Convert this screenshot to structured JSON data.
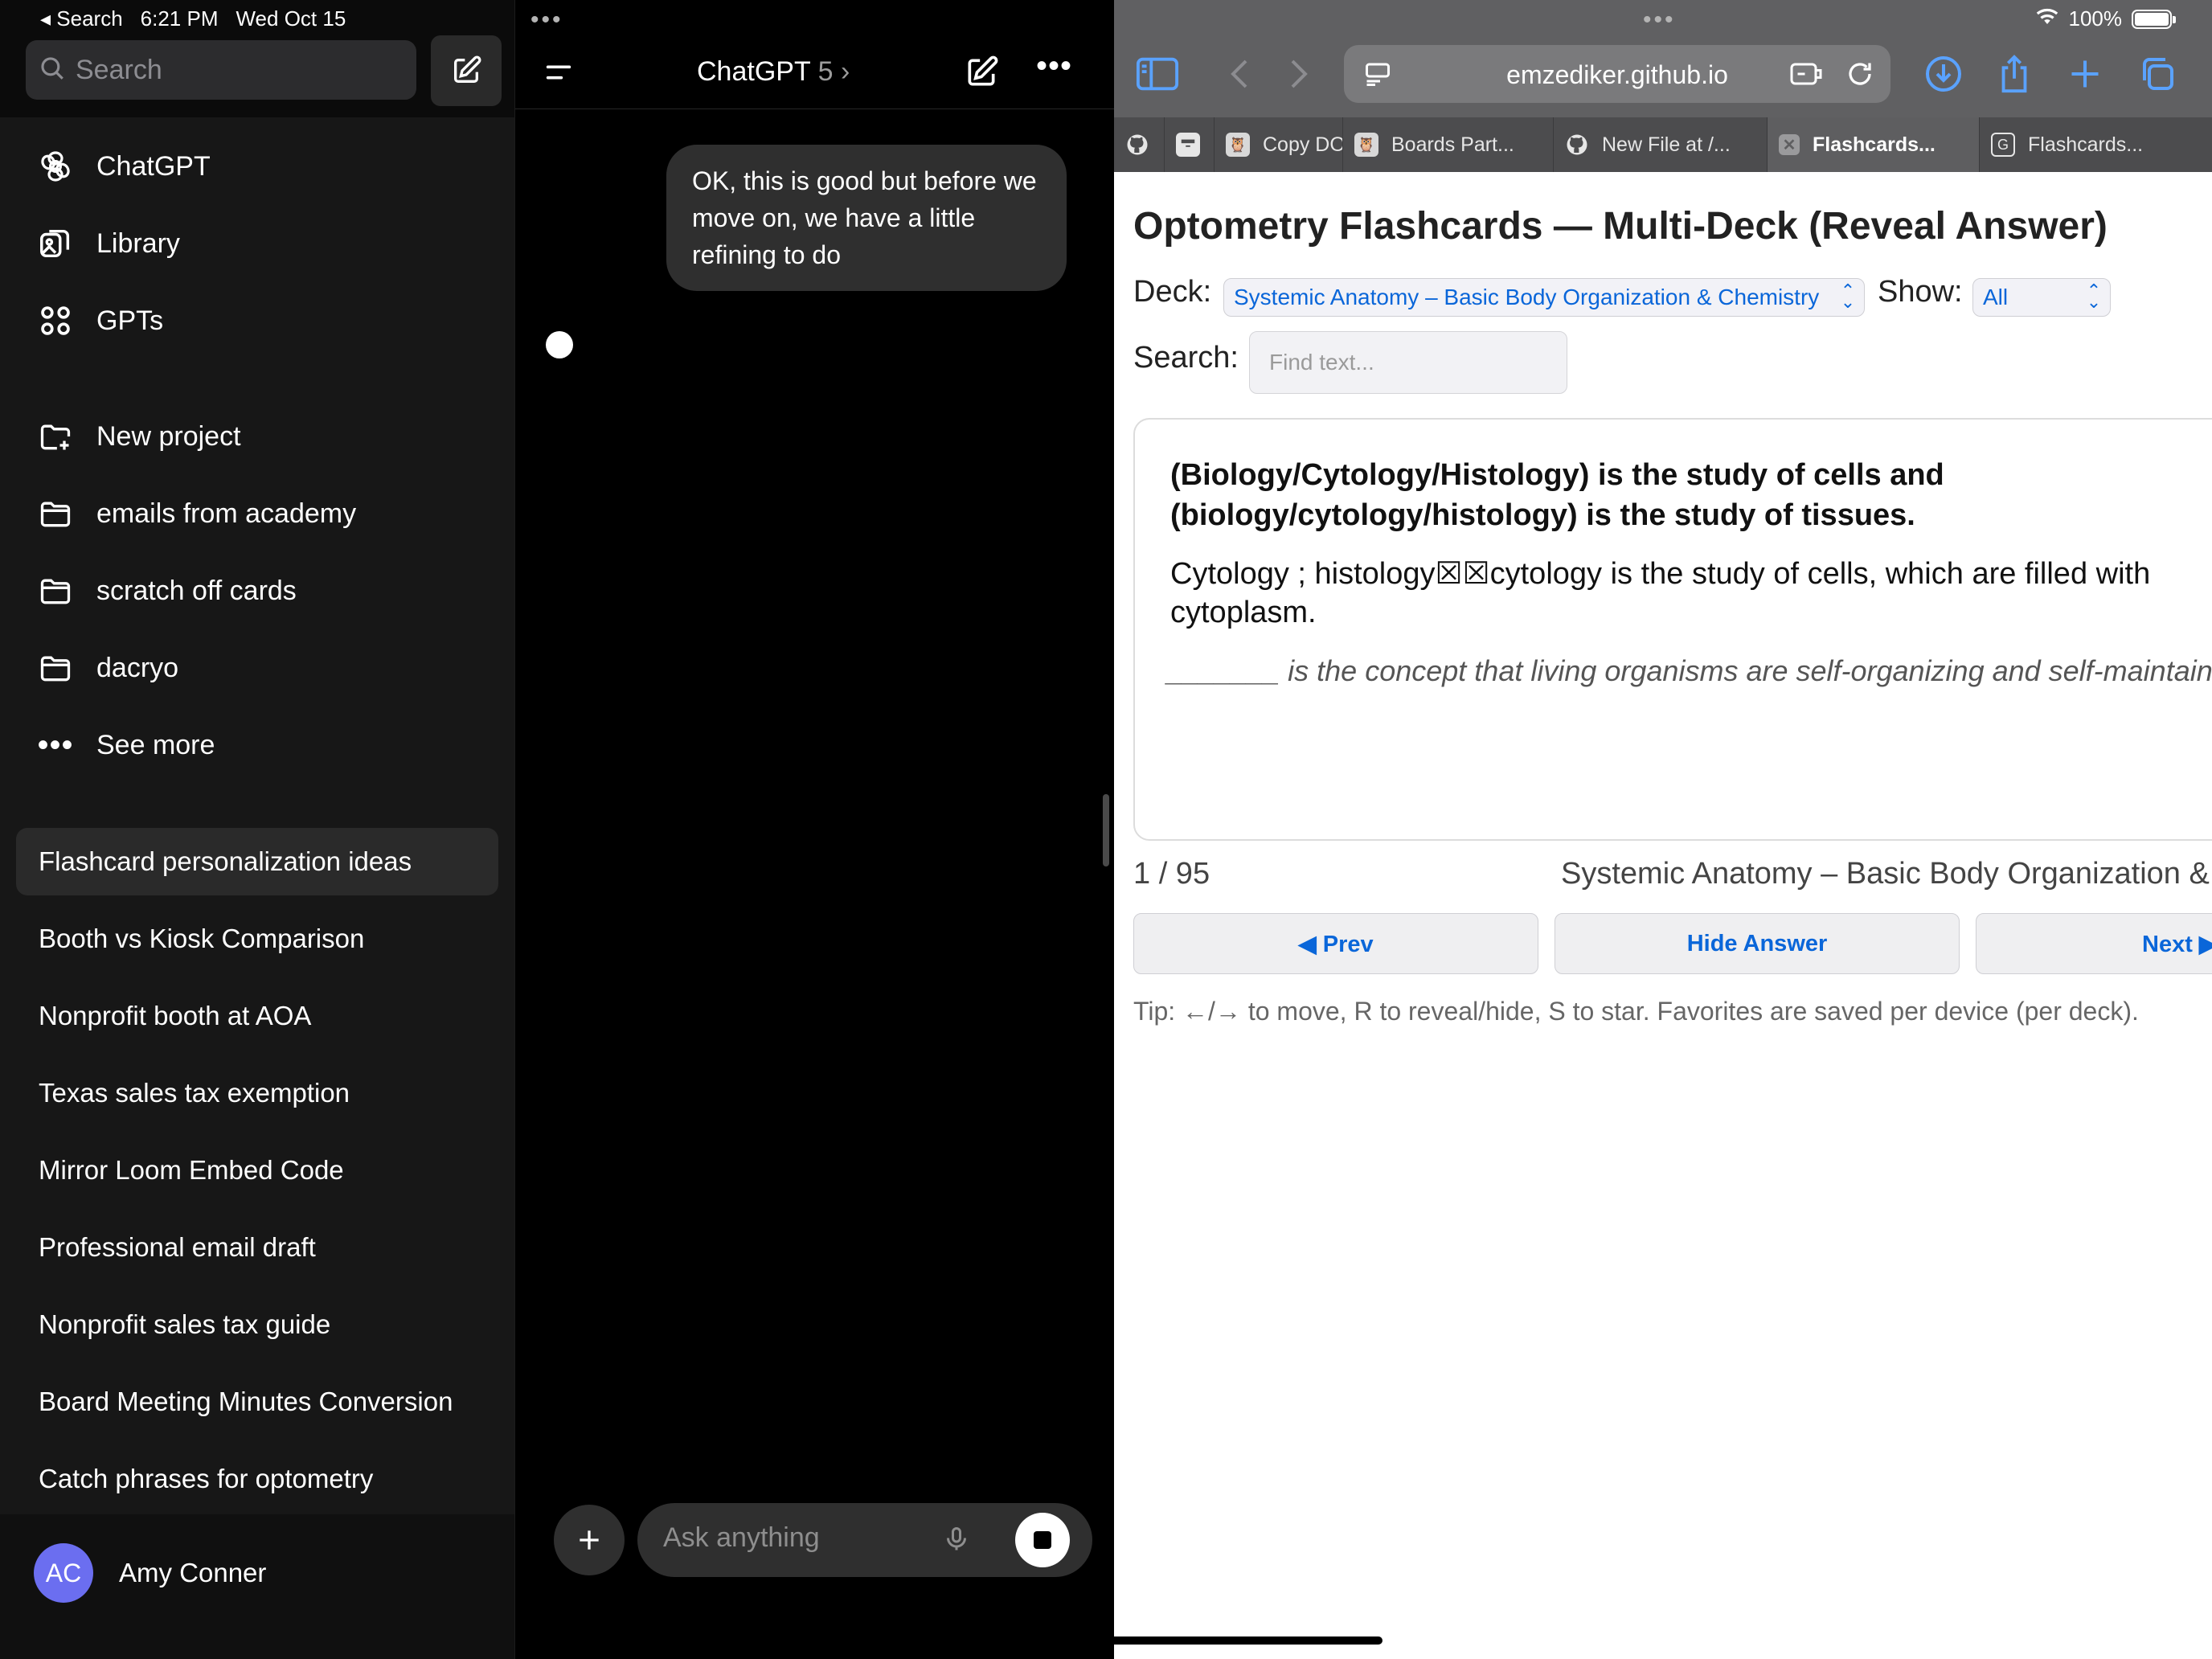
{
  "status_bar": {
    "back_label": "◂ Search",
    "time": "6:21 PM",
    "date": "Wed Oct 15",
    "battery": "100%"
  },
  "sidebar": {
    "search_placeholder": "Search",
    "nav": [
      {
        "label": "ChatGPT",
        "icon": "openai-logo-icon"
      },
      {
        "label": "Library",
        "icon": "library-icon"
      },
      {
        "label": "GPTs",
        "icon": "grid-icon"
      }
    ],
    "projects": [
      {
        "label": "New project",
        "icon": "folder-plus-icon"
      },
      {
        "label": "emails from academy",
        "icon": "folder-icon"
      },
      {
        "label": "scratch off cards",
        "icon": "folder-icon"
      },
      {
        "label": "dacryo",
        "icon": "folder-icon"
      },
      {
        "label": "See more",
        "icon": "ellipsis-icon"
      }
    ],
    "chats": [
      "Flashcard personalization ideas",
      "Booth vs Kiosk Comparison",
      "Nonprofit booth at AOA",
      "Texas sales tax exemption",
      "Mirror Loom Embed Code",
      "Professional email draft",
      "Nonprofit sales tax guide",
      "Board Meeting Minutes Conversion",
      "Catch phrases for optometry"
    ],
    "user": {
      "initials": "AC",
      "name": "Amy Conner",
      "avatar_color": "#6b6ef0"
    }
  },
  "chat": {
    "title": "ChatGPT",
    "model_version": "5",
    "message": "OK, this is good but before we move on, we have a little refining to do",
    "composer_placeholder": "Ask anything"
  },
  "browser": {
    "url": "emzediker.github.io",
    "tabs": [
      {
        "label": "",
        "icon": "github-icon"
      },
      {
        "label": "",
        "icon": "archive-icon"
      },
      {
        "label": "Copy DO",
        "icon": "owl-icon"
      },
      {
        "label": "Boards Part...",
        "icon": "owl-icon"
      },
      {
        "label": "New File at /...",
        "icon": "github-icon"
      },
      {
        "label": "Flashcards...",
        "icon": "x-favicon-icon",
        "active": true
      },
      {
        "label": "Flashcards...",
        "icon": "g-favicon-icon"
      }
    ]
  },
  "flashcards": {
    "title": "Optometry Flashcards — Multi-Deck (Reveal Answer)",
    "deck_label": "Deck:",
    "deck_value": "Systemic Anatomy – Basic Body Organization & Chemistry",
    "show_label": "Show:",
    "show_value": "All",
    "search_label": "Search:",
    "search_placeholder": "Find text...",
    "question": "(Biology/Cytology/Histology) is the study of cells and (biology/cytology/histology) is the study of tissues.",
    "answer": "Cytology ; histology☒☒cytology is the study of cells, which are filled with cytoplasm.",
    "next_clue": "_______ is the concept that living organisms are self-organizing and self-maintaining",
    "counter": "1 / 95",
    "deck_title": "Systemic Anatomy – Basic Body Organization & Chemistry",
    "prev_label": "◀ Prev",
    "hide_label": "Hide Answer",
    "next_label": "Next ▶",
    "tip": "Tip: ←/→ to move, R to reveal/hide, S to star. Favorites are saved per device (per deck)."
  },
  "colors": {
    "sidebar_bg": "#171717",
    "chat_bg": "#000000",
    "bubble_bg": "#2f2f2f",
    "safari_toolbar": "#606062",
    "link_blue": "#0a66d9"
  }
}
